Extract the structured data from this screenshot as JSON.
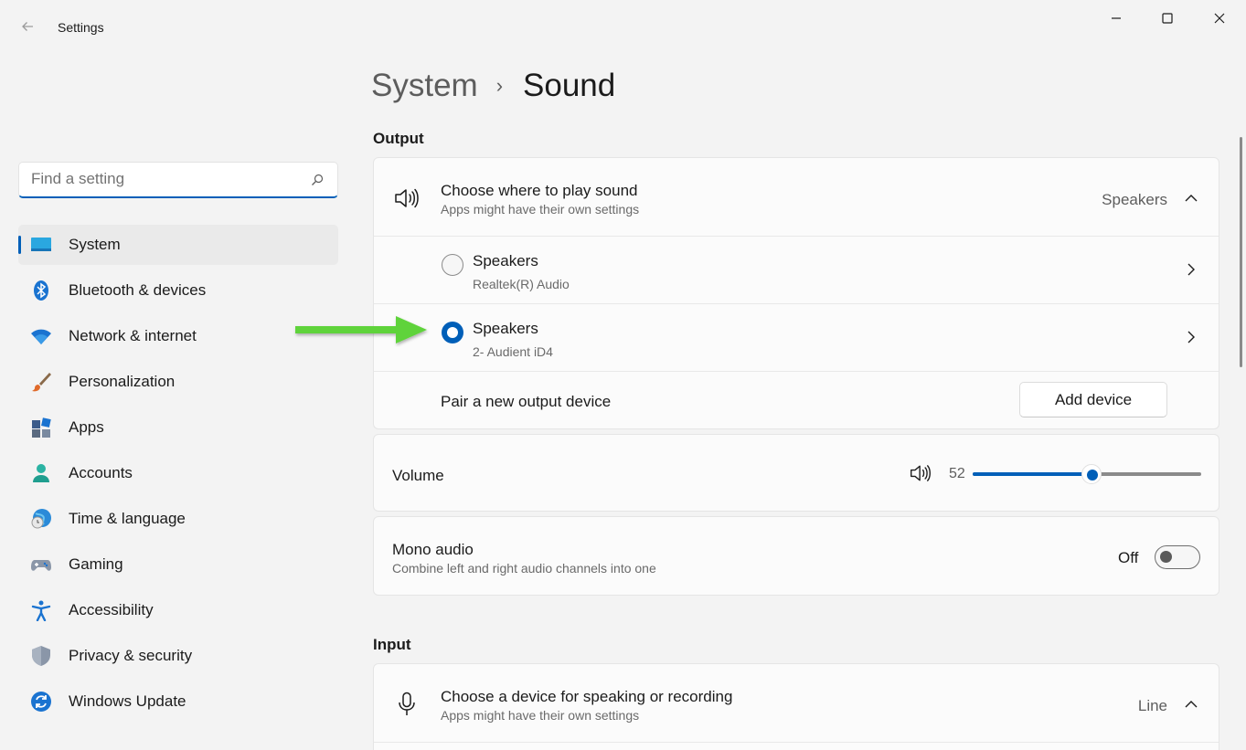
{
  "window": {
    "title": "Settings"
  },
  "search": {
    "placeholder": "Find a setting"
  },
  "sidebar": {
    "items": [
      {
        "label": "System",
        "icon": "system-display-icon",
        "active": true
      },
      {
        "label": "Bluetooth & devices",
        "icon": "bluetooth-icon"
      },
      {
        "label": "Network & internet",
        "icon": "wifi-icon"
      },
      {
        "label": "Personalization",
        "icon": "paintbrush-icon"
      },
      {
        "label": "Apps",
        "icon": "apps-icon"
      },
      {
        "label": "Accounts",
        "icon": "person-icon"
      },
      {
        "label": "Time & language",
        "icon": "globe-clock-icon"
      },
      {
        "label": "Gaming",
        "icon": "gamepad-icon"
      },
      {
        "label": "Accessibility",
        "icon": "accessibility-icon"
      },
      {
        "label": "Privacy & security",
        "icon": "shield-icon"
      },
      {
        "label": "Windows Update",
        "icon": "update-icon"
      }
    ]
  },
  "breadcrumb": {
    "parent": "System",
    "separator": "›",
    "current": "Sound"
  },
  "output": {
    "section_label": "Output",
    "choose": {
      "title": "Choose where to play sound",
      "subtitle": "Apps might have their own settings",
      "value": "Speakers"
    },
    "devices": [
      {
        "name": "Speakers",
        "detail": "Realtek(R) Audio",
        "selected": false
      },
      {
        "name": "Speakers",
        "detail": "2- Audient iD4",
        "selected": true
      }
    ],
    "pair": {
      "label": "Pair a new output device",
      "button": "Add device"
    }
  },
  "volume": {
    "label": "Volume",
    "value": "52",
    "level": 0.52
  },
  "mono": {
    "title": "Mono audio",
    "subtitle": "Combine left and right audio channels into one",
    "state": "Off"
  },
  "input": {
    "section_label": "Input",
    "choose": {
      "title": "Choose a device for speaking or recording",
      "subtitle": "Apps might have their own settings",
      "value": "Line"
    }
  },
  "colors": {
    "accent": "#005fb8",
    "annotation_arrow": "#5fd33a"
  }
}
